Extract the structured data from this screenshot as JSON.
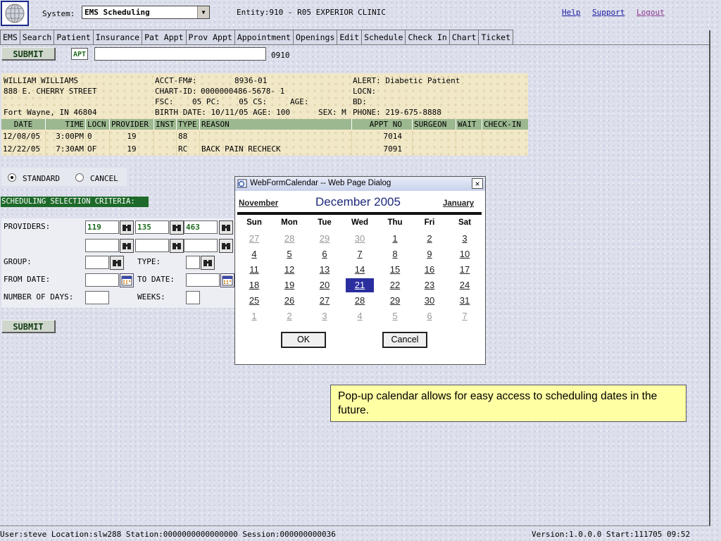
{
  "header": {
    "system_label": "System:",
    "system_value": "EMS Scheduling",
    "entity": "Entity:910 - R05 EXPERIOR CLINIC",
    "links": {
      "help": "Help",
      "support": "Support",
      "logout": "Logout"
    }
  },
  "nav": [
    "EMS",
    "Search",
    "Patient",
    "Insurance",
    "Pat Appt",
    "Prov Appt",
    "Appointment",
    "Openings",
    "Edit",
    "Schedule",
    "Check In",
    "Chart",
    "Ticket"
  ],
  "toolbar": {
    "submit_label": "SUBMIT",
    "apt_label": "APT",
    "apt_value": "",
    "code": "0910"
  },
  "patient": {
    "name": "WILLIAM WILLIAMS",
    "street": "888 E. CHERRY STREET",
    "city": "Fort Wayne, IN 46804",
    "acct_label": "ACCT-FM#:",
    "acct": "8936-01",
    "chart_label": "CHART-ID:",
    "chart": "0000000486-5678- 1",
    "fsc_line": "FSC:    05 PC:    05 CS:     AGE:",
    "birth_line": "BIRTH DATE: 10/11/05 AGE: 100",
    "sex_line": "SEX: M",
    "alert": "ALERT: Diabetic Patient",
    "locn": "LOCN:",
    "bd": "BD:",
    "phone": "PHONE: 219-675-8888"
  },
  "appointments": {
    "headers": [
      "DATE",
      "TIME",
      "LOCN",
      "PROVIDER",
      "INST",
      "TYPE",
      "REASON",
      "APPT NO",
      "SURGEON",
      "WAIT",
      "CHECK-IN"
    ],
    "rows": [
      [
        "12/08/05",
        "3:00PM",
        "0",
        "19",
        "",
        "88",
        "",
        "7014",
        "",
        "",
        ""
      ],
      [
        "12/22/05",
        "7:30AM",
        "OF",
        "19",
        "",
        "RC",
        "BACK PAIN RECHECK",
        "7091",
        "",
        "",
        ""
      ]
    ]
  },
  "appt_mode": {
    "standard": "STANDARD",
    "cancel": "CANCEL",
    "selected": "STANDARD"
  },
  "criteria": {
    "title": "SCHEDULING SELECTION CRITERIA:",
    "providers_label": "PROVIDERS:",
    "providers": [
      "119",
      "135",
      "463",
      "",
      "",
      ""
    ],
    "group_label": "GROUP:",
    "type_label": "TYPE:",
    "from_label": "FROM DATE:",
    "to_label": "TO DATE:",
    "days_label": "NUMBER OF DAYS:",
    "weeks_label": "WEEKS:",
    "submit_label": "SUBMIT"
  },
  "dialog": {
    "title": "WebFormCalendar -- Web Page Dialog",
    "close": "×",
    "prev_month": "November",
    "current_month": "December 2005",
    "next_month": "January",
    "weekdays": [
      "Sun",
      "Mon",
      "Tue",
      "Wed",
      "Thu",
      "Fri",
      "Sat"
    ],
    "weeks": [
      [
        "27",
        "28",
        "29",
        "30",
        "1",
        "2",
        "3"
      ],
      [
        "4",
        "5",
        "6",
        "7",
        "8",
        "9",
        "10"
      ],
      [
        "11",
        "12",
        "13",
        "14",
        "15",
        "16",
        "17"
      ],
      [
        "18",
        "19",
        "20",
        "21",
        "22",
        "23",
        "24"
      ],
      [
        "25",
        "26",
        "27",
        "28",
        "29",
        "30",
        "31"
      ],
      [
        "1",
        "2",
        "3",
        "4",
        "5",
        "6",
        "7"
      ]
    ],
    "selected_day": "21",
    "ok": "OK",
    "cancel": "Cancel"
  },
  "note": "Pop-up calendar allows for easy access to scheduling dates in the future.",
  "status": {
    "left": "User:steve Location:slw288 Station:0000000000000000 Session:000000000036",
    "right": "Version:1.0.0.0  Start:111705 09:52"
  },
  "colors": {
    "selected_day": "#2a2e9e",
    "criteria_bar": "#1e6a2a",
    "note_bg": "#ffffa4",
    "patient_bg": "#f1e8c8",
    "table_header": "#9cb890"
  }
}
